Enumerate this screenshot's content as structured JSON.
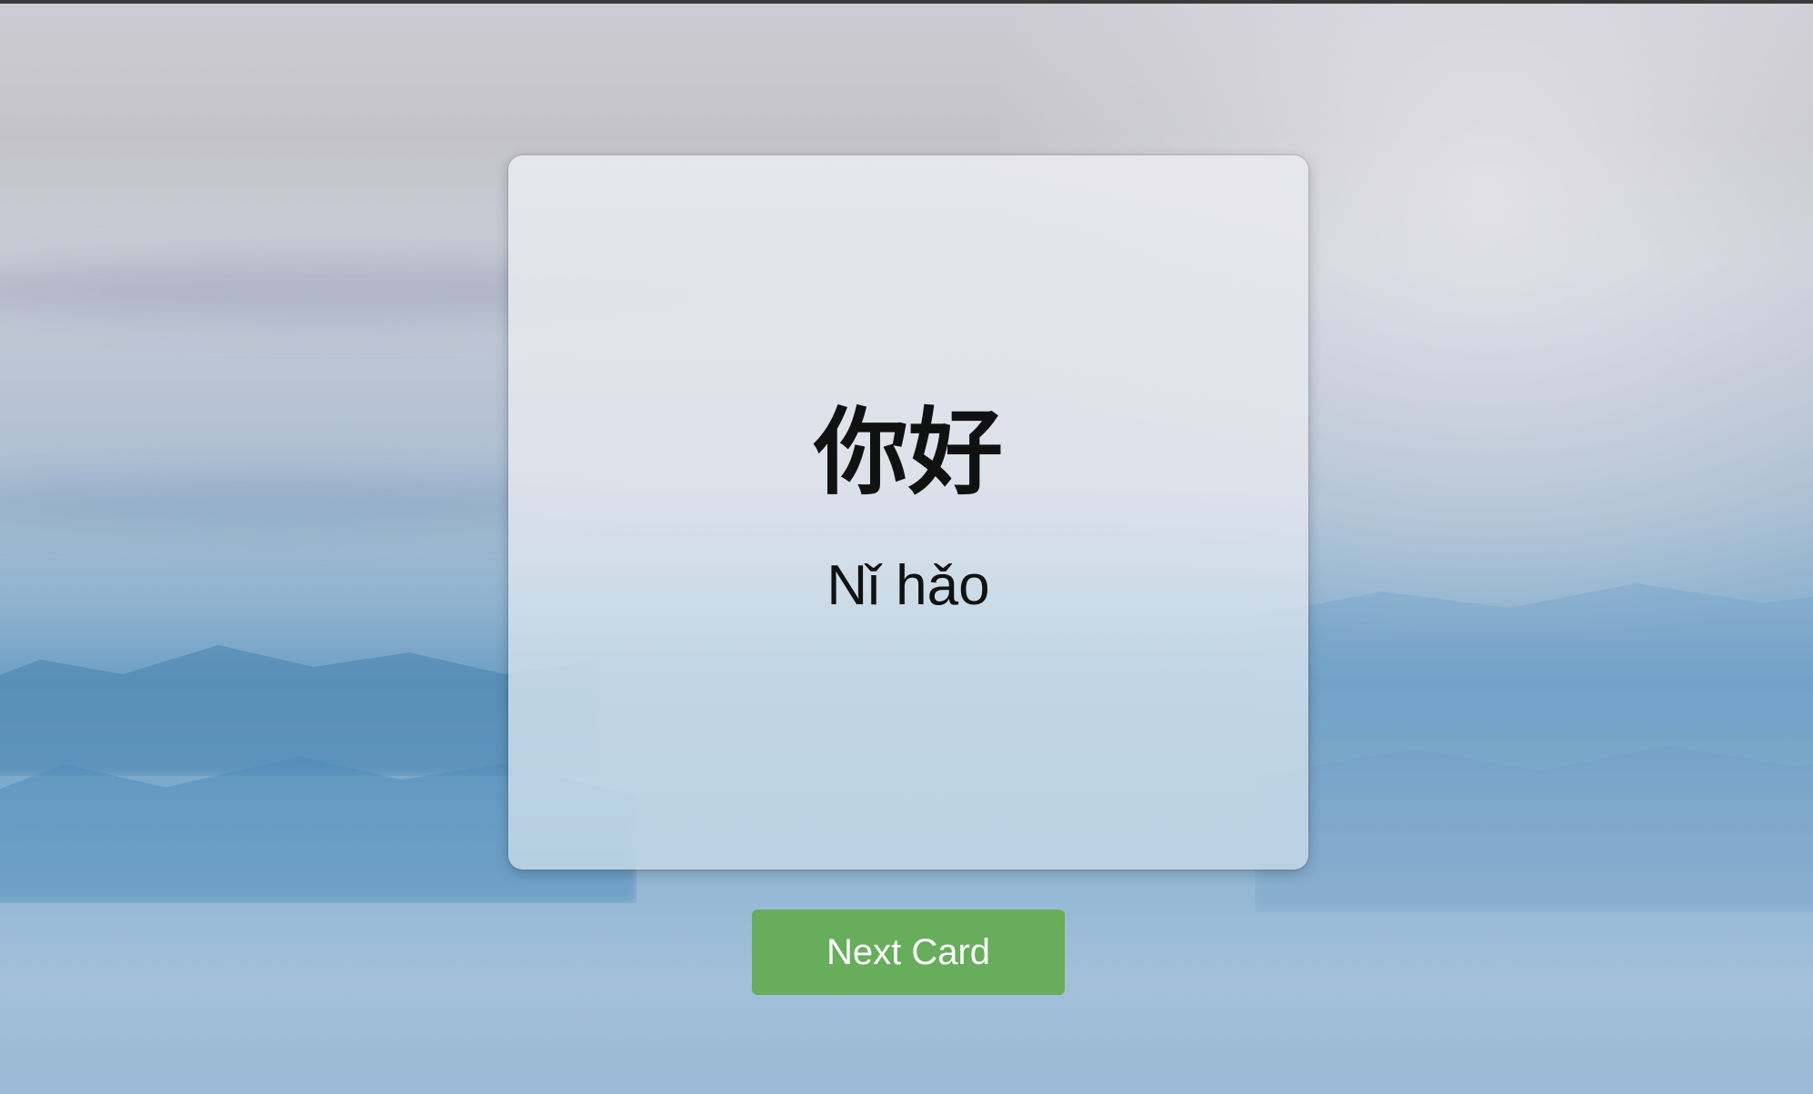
{
  "flashcard": {
    "character": "你好",
    "pinyin": "Nǐ hǎo"
  },
  "controls": {
    "next_label": "Next Card",
    "next_color": "#67ad5b"
  }
}
